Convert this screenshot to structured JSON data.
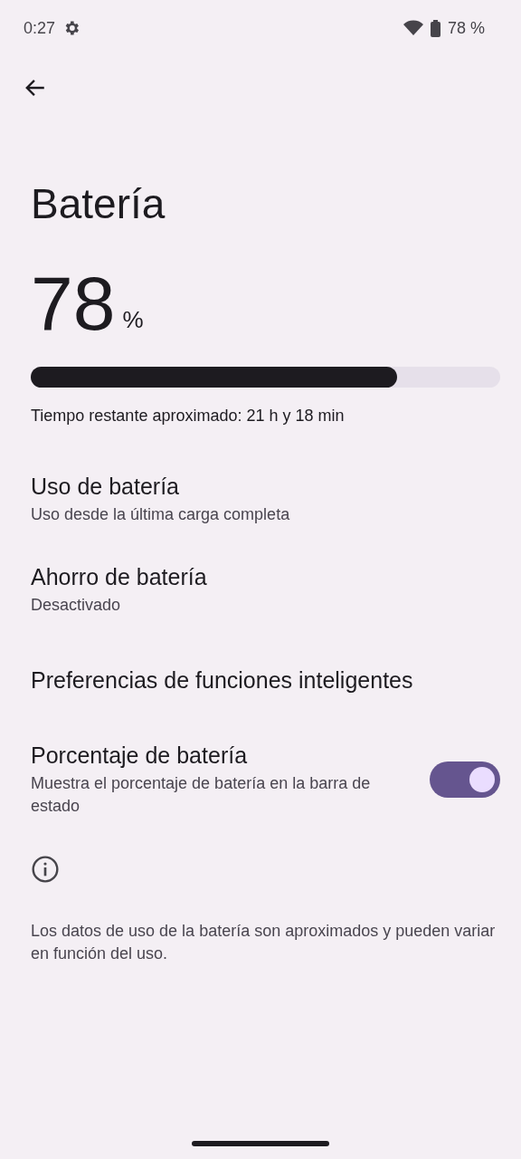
{
  "status_bar": {
    "time": "0:27",
    "battery": "78 %"
  },
  "title": "Batería",
  "charge": {
    "value": "78",
    "unit": "%",
    "level": 0.78
  },
  "estimate": "Tiempo restante aproximado: 21 h y 18 min",
  "items": [
    {
      "kind": "link",
      "title": "Uso de batería",
      "subtitle": "Uso desde la última carga completa"
    },
    {
      "kind": "link",
      "title": "Ahorro de batería",
      "subtitle": "Desactivado"
    },
    {
      "kind": "link",
      "title": "Preferencias de funciones inteligentes"
    },
    {
      "kind": "switch",
      "title": "Porcentaje de batería",
      "subtitle": "Muestra el porcentaje de batería en la barra de estado",
      "on": true
    }
  ],
  "footer": "Los datos de uso de la batería son aproximados y pueden variar en función del uso."
}
